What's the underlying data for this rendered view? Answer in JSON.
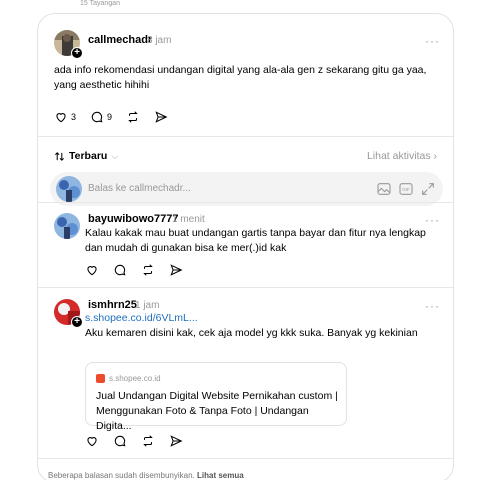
{
  "top": {
    "faded_text": "15 Tayangan"
  },
  "post": {
    "username": "callmechadr",
    "time": "3 jam",
    "more": "···",
    "text": "ada info rekomendasi undangan digital yang ala-ala gen z sekarang gitu ga yaa, yang aesthetic hihihi",
    "like_count": "3",
    "reply_count": "9"
  },
  "sort": {
    "label": "Terbaru",
    "activity": "Lihat aktivitas"
  },
  "reply_box": {
    "placeholder": "Balas ke callmechadr..."
  },
  "replies": [
    {
      "username": "bayuwibowo7777",
      "time": "1 menit",
      "text": "Kalau kakak mau buat undangan gartis tanpa bayar dan fitur nya lengkap dan mudah di gunakan bisa ke mer(.)id kak"
    },
    {
      "username": "ismhrn25",
      "time": "1 jam",
      "link": "s.shopee.co.id/6VLmL...",
      "text": "Aku kemaren disini kak, cek aja model yg kkk suka. Banyak yg kekinian",
      "preview": {
        "domain": "s.shopee.co.id",
        "title": "Jual Undangan Digital Website Pernikahan custom | Menggunakan Foto & Tanpa Foto | Undangan Digita..."
      }
    }
  ],
  "footer": {
    "note": "Beberapa balasan sudah disembunyikan.",
    "link": "Lihat semua"
  },
  "colors": {
    "link": "#1d6fbf",
    "shopee": "#ee4d2d",
    "muted": "#999999"
  },
  "icons": [
    "heart-icon",
    "comment-icon",
    "repost-icon",
    "share-icon",
    "sort-icon",
    "gif-icon",
    "image-icon",
    "expand-icon"
  ]
}
